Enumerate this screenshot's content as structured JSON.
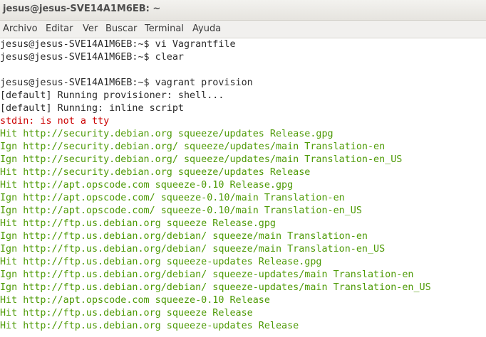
{
  "window": {
    "title": "jesus@jesus-SVE14A1M6EB: ~"
  },
  "menu": {
    "items": [
      "Archivo",
      "Editar",
      "Ver",
      "Buscar",
      "Terminal",
      "Ayuda"
    ]
  },
  "colors": {
    "text": "#2b2b2b",
    "error": "#cc0000",
    "ok": "#4e9a06"
  },
  "terminal": {
    "lines": [
      {
        "text": "jesus@jesus-SVE14A1M6EB:~$ vi Vagrantfile",
        "kind": "text"
      },
      {
        "text": "jesus@jesus-SVE14A1M6EB:~$ clear",
        "kind": "text"
      },
      {
        "text": "",
        "kind": "text"
      },
      {
        "text": "jesus@jesus-SVE14A1M6EB:~$ vagrant provision",
        "kind": "text"
      },
      {
        "text": "[default] Running provisioner: shell...",
        "kind": "text"
      },
      {
        "text": "[default] Running: inline script",
        "kind": "text"
      },
      {
        "text": "stdin: is not a tty",
        "kind": "error"
      },
      {
        "text": "Hit http://security.debian.org squeeze/updates Release.gpg",
        "kind": "ok"
      },
      {
        "text": "Ign http://security.debian.org/ squeeze/updates/main Translation-en",
        "kind": "ok"
      },
      {
        "text": "Ign http://security.debian.org/ squeeze/updates/main Translation-en_US",
        "kind": "ok"
      },
      {
        "text": "Hit http://security.debian.org squeeze/updates Release",
        "kind": "ok"
      },
      {
        "text": "Hit http://apt.opscode.com squeeze-0.10 Release.gpg",
        "kind": "ok"
      },
      {
        "text": "Ign http://apt.opscode.com/ squeeze-0.10/main Translation-en",
        "kind": "ok"
      },
      {
        "text": "Ign http://apt.opscode.com/ squeeze-0.10/main Translation-en_US",
        "kind": "ok"
      },
      {
        "text": "Hit http://ftp.us.debian.org squeeze Release.gpg",
        "kind": "ok"
      },
      {
        "text": "Ign http://ftp.us.debian.org/debian/ squeeze/main Translation-en",
        "kind": "ok"
      },
      {
        "text": "Ign http://ftp.us.debian.org/debian/ squeeze/main Translation-en_US",
        "kind": "ok"
      },
      {
        "text": "Hit http://ftp.us.debian.org squeeze-updates Release.gpg",
        "kind": "ok"
      },
      {
        "text": "Ign http://ftp.us.debian.org/debian/ squeeze-updates/main Translation-en",
        "kind": "ok"
      },
      {
        "text": "Ign http://ftp.us.debian.org/debian/ squeeze-updates/main Translation-en_US",
        "kind": "ok"
      },
      {
        "text": "Hit http://apt.opscode.com squeeze-0.10 Release",
        "kind": "ok"
      },
      {
        "text": "Hit http://ftp.us.debian.org squeeze Release",
        "kind": "ok"
      },
      {
        "text": "Hit http://ftp.us.debian.org squeeze-updates Release",
        "kind": "ok"
      }
    ]
  }
}
